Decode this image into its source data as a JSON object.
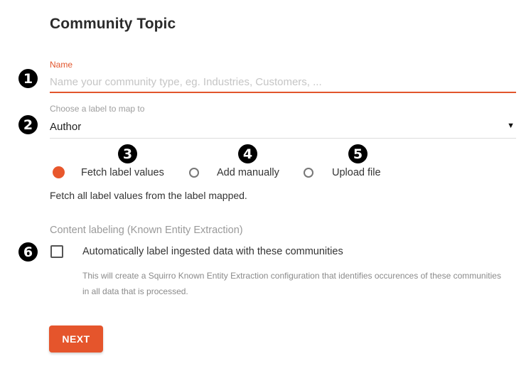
{
  "page": {
    "title": "Community Topic"
  },
  "markers": [
    "1",
    "2",
    "3",
    "4",
    "5",
    "6"
  ],
  "name_field": {
    "label": "Name",
    "placeholder": "Name your community type, eg. Industries, Customers, ...",
    "value": ""
  },
  "label_select": {
    "label": "Choose a label to map to",
    "value": "Author"
  },
  "values_source": {
    "options": [
      {
        "label": "Fetch label values",
        "checked": true
      },
      {
        "label": "Add manually",
        "checked": false
      },
      {
        "label": "Upload file",
        "checked": false
      }
    ],
    "description": "Fetch all label values from the label mapped."
  },
  "content_labeling": {
    "section_label": "Content labeling (Known Entity Extraction)",
    "checkbox_label": "Automatically label ingested data with these communities",
    "checked": false,
    "help_text": "This will create a Squirro Known Entity Extraction configuration that identifies occurences of these communities in all data that is processed."
  },
  "actions": {
    "next_label": "NEXT"
  },
  "colors": {
    "accent": "#e5552c",
    "marker": "#000000"
  }
}
